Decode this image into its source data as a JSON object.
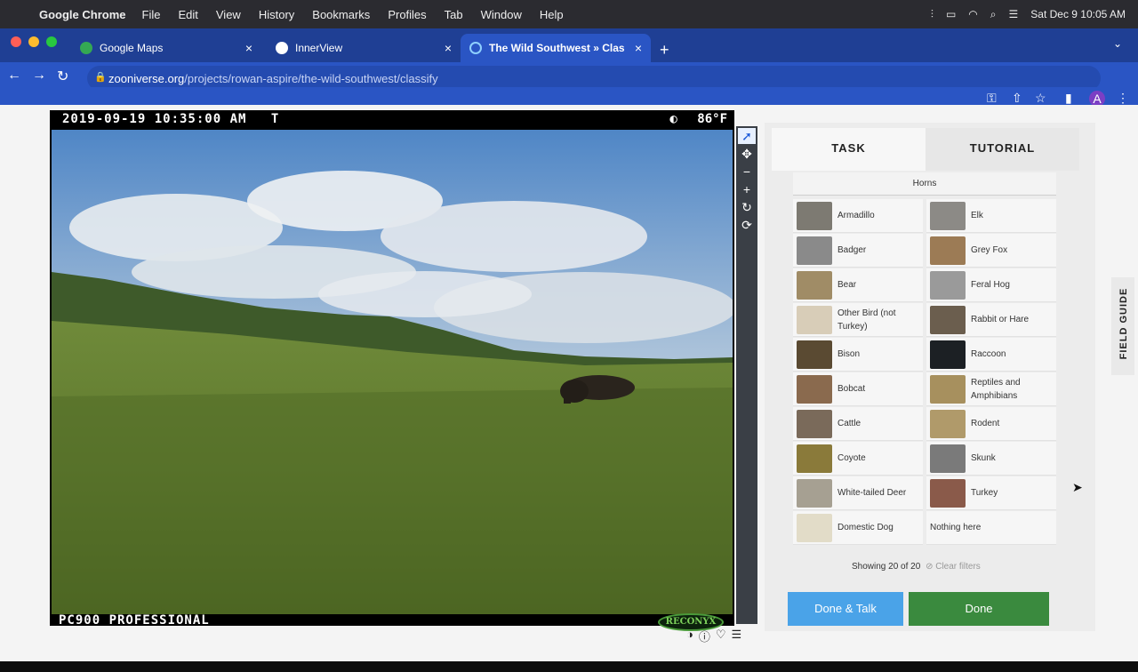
{
  "menubar": {
    "app": "Google Chrome",
    "items": [
      "File",
      "Edit",
      "View",
      "History",
      "Bookmarks",
      "Profiles",
      "Tab",
      "Window",
      "Help"
    ],
    "datetime": "Sat Dec 9  10:05 AM"
  },
  "tabs": [
    {
      "label": "Google Maps"
    },
    {
      "label": "InnerView"
    },
    {
      "label": "The Wild Southwest » Classify"
    }
  ],
  "address": {
    "host": "zooniverse.org",
    "path": "/projects/rowan-aspire/the-wild-southwest/classify"
  },
  "camera": {
    "timestamp": "2019-09-19 10:35:00 AM",
    "moon_code": "T",
    "temperature": "86°F",
    "model": "PC900 PROFESSIONAL",
    "brand": "RECONYX"
  },
  "panel": {
    "tab_task": "TASK",
    "tab_tutorial": "TUTORIAL",
    "filter_label": "Horns",
    "species": [
      {
        "name": "Armadillo",
        "color": "#7d7a72"
      },
      {
        "name": "Elk",
        "color": "#8c8a86"
      },
      {
        "name": "Badger",
        "color": "#8a8a8a"
      },
      {
        "name": "Grey Fox",
        "color": "#9c7b55"
      },
      {
        "name": "Bear",
        "color": "#a08c66"
      },
      {
        "name": "Feral Hog",
        "color": "#9a9a9a"
      },
      {
        "name": "Other Bird (not Turkey)",
        "color": "#d8cdb8"
      },
      {
        "name": "Rabbit or Hare",
        "color": "#6b5e4e"
      },
      {
        "name": "Bison",
        "color": "#5a4a32"
      },
      {
        "name": "Raccoon",
        "color": "#1c2024"
      },
      {
        "name": "Bobcat",
        "color": "#8a6a4e"
      },
      {
        "name": "Reptiles and Amphibians",
        "color": "#a7905e"
      },
      {
        "name": "Cattle",
        "color": "#7a6a5a"
      },
      {
        "name": "Rodent",
        "color": "#b09a6a"
      },
      {
        "name": "Coyote",
        "color": "#8a7a3a"
      },
      {
        "name": "Skunk",
        "color": "#7a7a7a"
      },
      {
        "name": "White-tailed Deer",
        "color": "#a6a092"
      },
      {
        "name": "Turkey",
        "color": "#8a5a4a"
      },
      {
        "name": "Domestic Dog",
        "color": "#e2dcc8"
      },
      {
        "name": "Nothing here",
        "color": ""
      }
    ],
    "showing": "Showing 20 of 20",
    "clear_filters": "Clear filters",
    "done_talk": "Done & Talk",
    "done": "Done",
    "field_guide": "FIELD GUIDE"
  },
  "colors": {
    "chrome_tab_bar": "#1f3f94",
    "chrome_toolbar": "#2a55c4",
    "done_talk": "#4aa3e8",
    "done": "#3a8a3e"
  }
}
